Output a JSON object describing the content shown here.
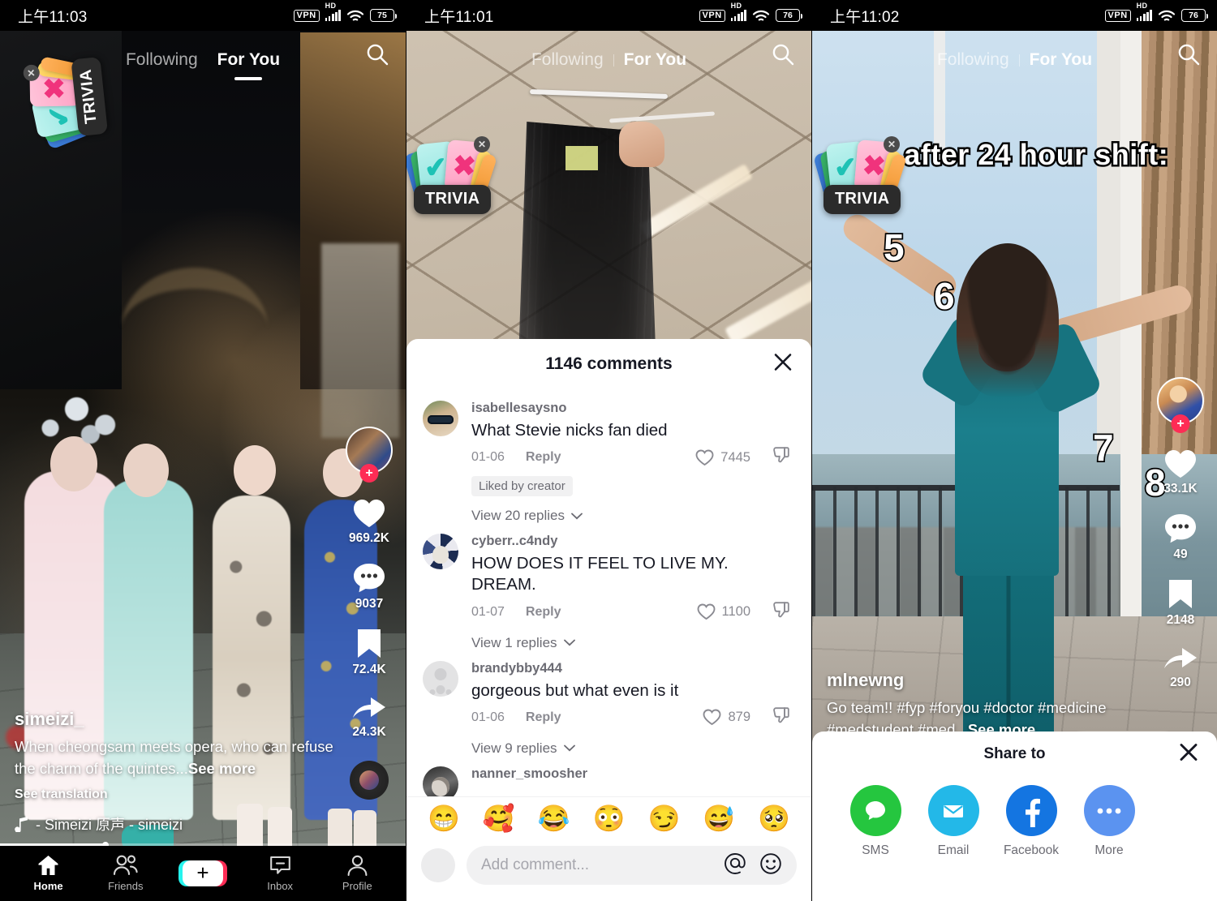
{
  "panels": [
    {
      "id": "feed-default",
      "status_bar": {
        "time": "上午11:03",
        "vpn": "VPN",
        "hd": "HD",
        "battery": "75"
      },
      "top_nav": {
        "following": "Following",
        "for_you": "For You",
        "active": "For You"
      },
      "sticker": {
        "label": "TRIVIA",
        "close": "✕"
      },
      "rail": {
        "like_count": "969.2K",
        "comment_count": "9037",
        "bookmark_count": "72.4K",
        "share_count": "24.3K",
        "follow_plus": "+"
      },
      "caption": {
        "username": "simeizi_",
        "text": "When cheongsam meets opera, who can refuse the charm of the quintes...",
        "see_more": "See more",
        "see_translation": "See translation",
        "music": "- Simeizi   原声 - simeizi"
      },
      "progress_percent": 26,
      "bottom_nav": [
        {
          "label": "Home",
          "icon": "home-icon",
          "active": true
        },
        {
          "label": "Friends",
          "icon": "friends-icon",
          "active": false
        },
        {
          "label": "",
          "icon": "create-plus-icon",
          "active": false
        },
        {
          "label": "Inbox",
          "icon": "inbox-icon",
          "active": false
        },
        {
          "label": "Profile",
          "icon": "profile-icon",
          "active": false
        }
      ]
    },
    {
      "id": "feed-comments",
      "status_bar": {
        "time": "上午11:01",
        "vpn": "VPN",
        "hd": "HD",
        "battery": "76"
      },
      "top_nav": {
        "following": "Following",
        "for_you": "For You",
        "active": "For You"
      },
      "sticker": {
        "label": "TRIVIA",
        "close": "✕"
      },
      "comments_sheet": {
        "title": "1146 comments",
        "close": "✕",
        "comments": [
          {
            "username": "isabellesaysno",
            "text": "What Stevie nicks fan died",
            "date": "01-06",
            "reply": "Reply",
            "likes": "7445",
            "badge": "Liked by creator",
            "replies_label": "View 20 replies"
          },
          {
            "username": "cyberr..c4ndy",
            "text": "HOW DOES IT FEEL TO LIVE MY. DREAM.",
            "date": "01-07",
            "reply": "Reply",
            "likes": "1100",
            "badge": "",
            "replies_label": "View 1 replies"
          },
          {
            "username": "brandybby444",
            "text": "gorgeous but what even is it",
            "date": "01-06",
            "reply": "Reply",
            "likes": "879",
            "badge": "",
            "replies_label": "View 9 replies"
          },
          {
            "username": "nanner_smoosher",
            "text": "",
            "date": "",
            "reply": "",
            "likes": "",
            "badge": "",
            "replies_label": ""
          }
        ],
        "quick_emojis": [
          "😁",
          "🥰",
          "😂",
          "😳",
          "😏",
          "😅",
          "🥺"
        ],
        "composer": {
          "placeholder": "Add comment...",
          "mention_icon": "at-icon",
          "emoji_icon": "emoji-face-icon"
        }
      }
    },
    {
      "id": "feed-share",
      "status_bar": {
        "time": "上午11:02",
        "vpn": "VPN",
        "hd": "HD",
        "battery": "76"
      },
      "top_nav": {
        "following": "Following",
        "for_you": "For You",
        "active": "For You"
      },
      "sticker": {
        "label": "TRIVIA",
        "close": "✕"
      },
      "video_text": "Me after 24 hour shift:",
      "video_numbers": [
        "5",
        "6",
        "7",
        "8"
      ],
      "rail": {
        "like_count": "33.1K",
        "comment_count": "49",
        "bookmark_count": "2148",
        "share_count": "290",
        "follow_plus": "+"
      },
      "caption": {
        "username": "mlnewng",
        "text": "Go team!! #fyp #foryou #doctor #medicine #medstudent #med...",
        "see_more": "See more"
      },
      "share_sheet": {
        "title": "Share to",
        "close": "✕",
        "targets": [
          {
            "label": "SMS",
            "icon": "sms-bubble-icon",
            "color": "#25c63f"
          },
          {
            "label": "Email",
            "icon": "envelope-icon",
            "color": "#23b8e8"
          },
          {
            "label": "Facebook",
            "icon": "facebook-icon",
            "color": "#1475e1"
          },
          {
            "label": "More",
            "icon": "more-dots-icon",
            "color": "#5b93f0"
          }
        ]
      }
    }
  ],
  "colors": {
    "accent_red": "#fe2c55",
    "accent_cyan": "#25f4ee",
    "text_dark": "#161823",
    "text_muted": "#8a8a91",
    "sheet_bg": "#ffffff"
  }
}
